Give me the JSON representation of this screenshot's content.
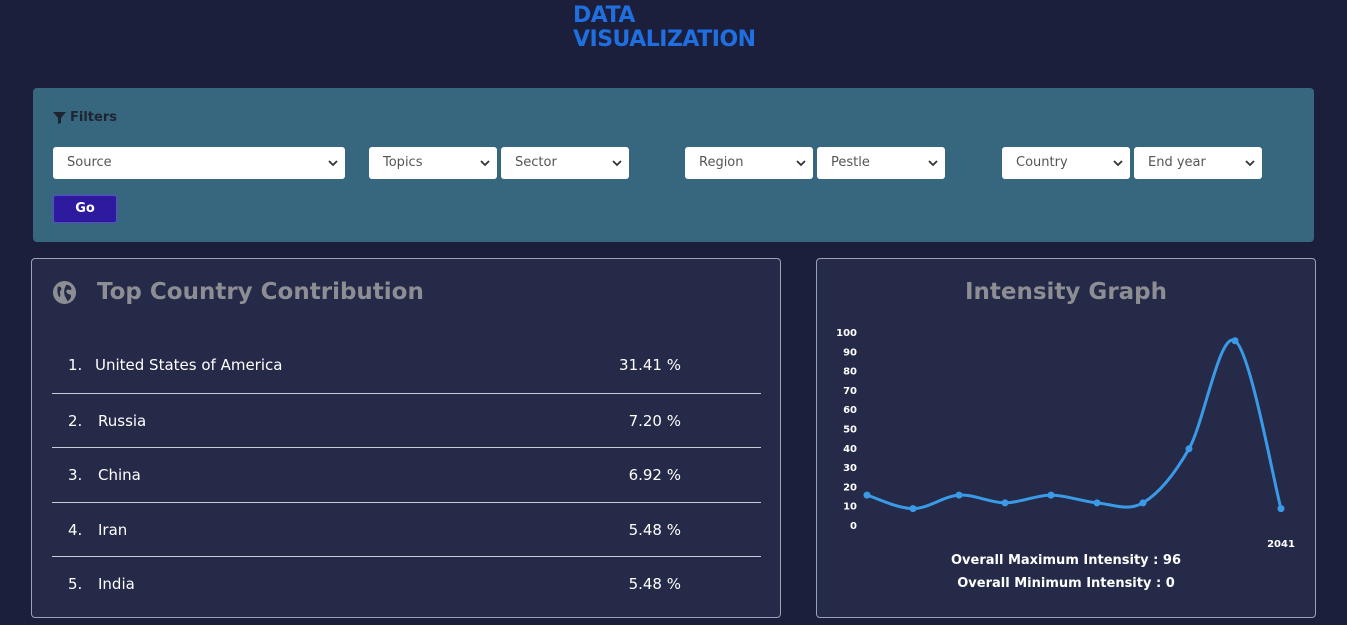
{
  "brand": {
    "line1": "DATA",
    "line2": "VISUALIZATION",
    "color": "#1f6fe0"
  },
  "filters": {
    "heading": "Filters",
    "source": "Source",
    "topics": "Topics",
    "sector": "Sector",
    "region": "Region",
    "pestle": "Pestle",
    "country": "Country",
    "end_year": "End year",
    "go": "Go"
  },
  "top_countries": {
    "title": "Top Country Contribution",
    "rows": [
      {
        "num": "1.",
        "name": "United States of America",
        "pct": "31.41 %"
      },
      {
        "num": "2.",
        "name": "Russia",
        "pct": "7.20 %"
      },
      {
        "num": "3.",
        "name": "China",
        "pct": "6.92 %"
      },
      {
        "num": "4.",
        "name": "Iran",
        "pct": "5.48 %"
      },
      {
        "num": "5.",
        "name": "India",
        "pct": "5.48 %"
      }
    ]
  },
  "intensity": {
    "title": "Intensity Graph",
    "max_text": "Overall Maximum Intensity : 96",
    "min_text": "Overall Minimum Intensity : 0"
  },
  "chart_data": {
    "type": "line",
    "title": "Intensity Graph",
    "ylim": [
      0,
      100
    ],
    "y_ticks": [
      0,
      10,
      20,
      30,
      40,
      50,
      60,
      70,
      80,
      90,
      100
    ],
    "x_tick_labels": [
      "2041"
    ],
    "values": [
      16,
      9,
      16,
      12,
      16,
      12,
      12,
      40,
      96,
      9
    ],
    "line_color": "#3b9ae8",
    "grid": false
  }
}
